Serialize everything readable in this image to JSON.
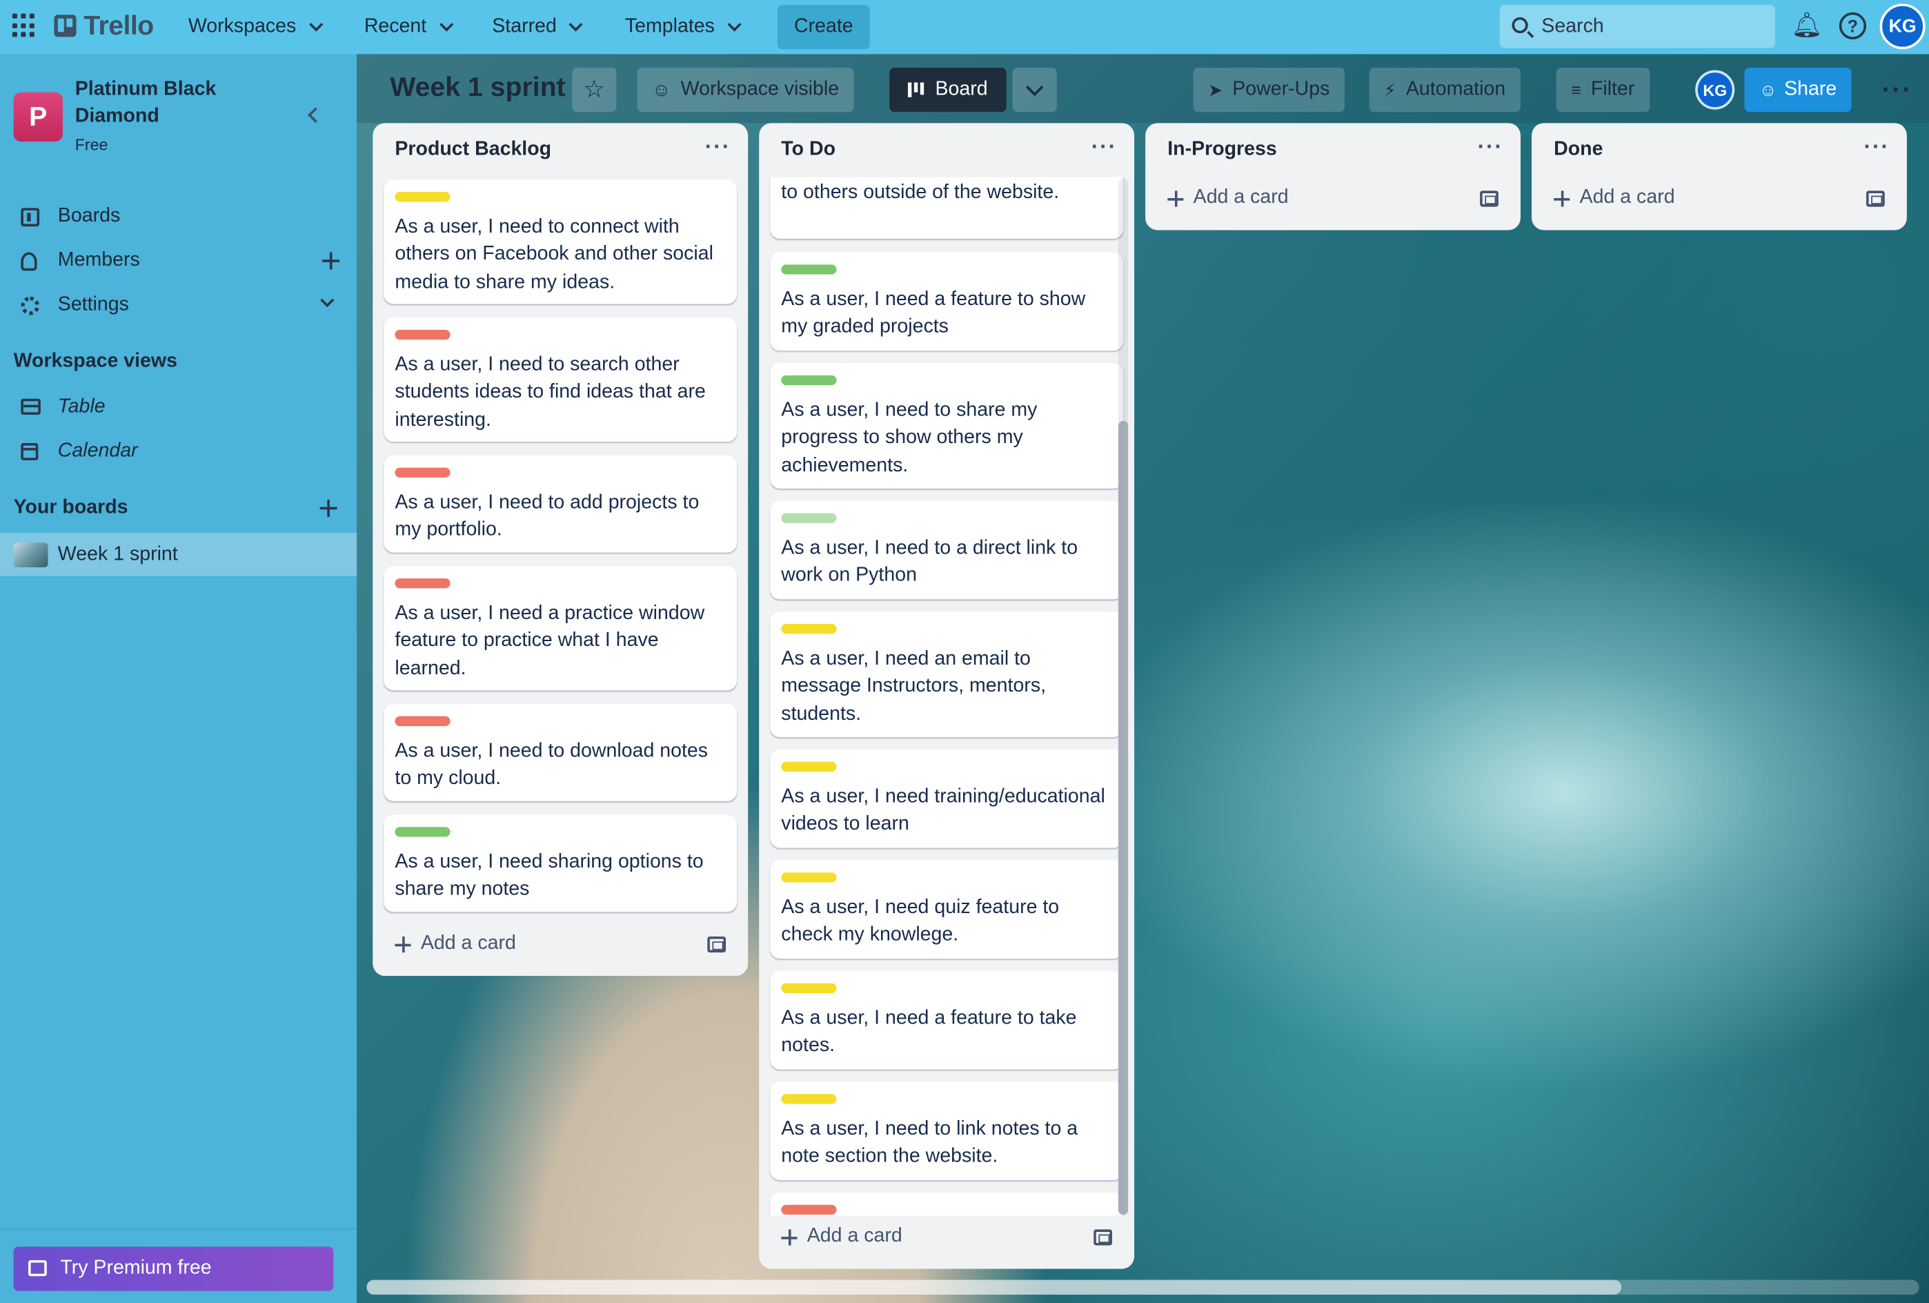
{
  "topnav": {
    "app_name": "Trello",
    "workspaces": "Workspaces",
    "recent": "Recent",
    "starred": "Starred",
    "templates": "Templates",
    "create": "Create",
    "search_placeholder": "Search",
    "avatar_initials": "KG",
    "help_glyph": "?"
  },
  "sidebar": {
    "workspace_initial": "P",
    "workspace_name": "Platinum Black Diamond",
    "workspace_plan": "Free",
    "items": [
      {
        "label": "Boards"
      },
      {
        "label": "Members"
      },
      {
        "label": "Settings"
      }
    ],
    "views_heading": "Workspace views",
    "views": [
      {
        "label": "Table"
      },
      {
        "label": "Calendar"
      }
    ],
    "your_boards_heading": "Your boards",
    "boards": [
      {
        "label": "Week 1 sprint"
      }
    ],
    "premium": "Try Premium free"
  },
  "board": {
    "title": "Week 1 sprint",
    "visibility": "Workspace visible",
    "view": "Board",
    "power_ups": "Power-Ups",
    "automation": "Automation",
    "filter": "Filter",
    "member_initials": "KG",
    "share": "Share",
    "more_glyph": "···"
  },
  "lists": [
    {
      "title": "Product Backlog",
      "cards": [
        {
          "label_color": "#f5dd29",
          "text": "As a user, I need to connect with others on Facebook and other social media to share my ideas."
        },
        {
          "label_color": "#ef7564",
          "text": "As a user, I need to search other students ideas to find ideas that are interesting."
        },
        {
          "label_color": "#ef7564",
          "text": "As a user, I need to add projects to my portfolio."
        },
        {
          "label_color": "#ef7564",
          "text": "As a user, I need a practice window feature to practice what I have learned."
        },
        {
          "label_color": "#ef7564",
          "text": "As a user, I need to download notes to my cloud."
        },
        {
          "label_color": "#7bc86c",
          "text": "As a user, I need sharing options to share my notes"
        }
      ],
      "add_card": "Add a card"
    },
    {
      "title": "To Do",
      "cards": [
        {
          "label_color": "",
          "text": "As a user, I need to share my posts to others outside of the website."
        },
        {
          "label_color": "#7bc86c",
          "text": "As a user, I need a feature to show my graded projects"
        },
        {
          "label_color": "#7bc86c",
          "text": "As a user, I need to share my progress to show others my achievements."
        },
        {
          "label_color": "#b3dfae",
          "text": "As a user, I need to a direct link to work on Python"
        },
        {
          "label_color": "#f5dd29",
          "text": "As a user, I need an email to message Instructors, mentors, students."
        },
        {
          "label_color": "#f5dd29",
          "text": "As a user, I need training/educational videos to learn"
        },
        {
          "label_color": "#f5dd29",
          "text": "As a user, I need quiz feature to check my knowlege."
        },
        {
          "label_color": "#f5dd29",
          "text": "As a user, I need a feature to take notes."
        },
        {
          "label_color": "#f5dd29",
          "text": "As a user, I need to link notes to a note section the website."
        },
        {
          "label_color": "#ef7564",
          "text": ""
        }
      ],
      "add_card": "Add a card"
    },
    {
      "title": "In-Progress",
      "cards": [],
      "add_card": "Add a card"
    },
    {
      "title": "Done",
      "cards": [],
      "add_card": "Add a card"
    }
  ],
  "list_menu_glyph": "···"
}
